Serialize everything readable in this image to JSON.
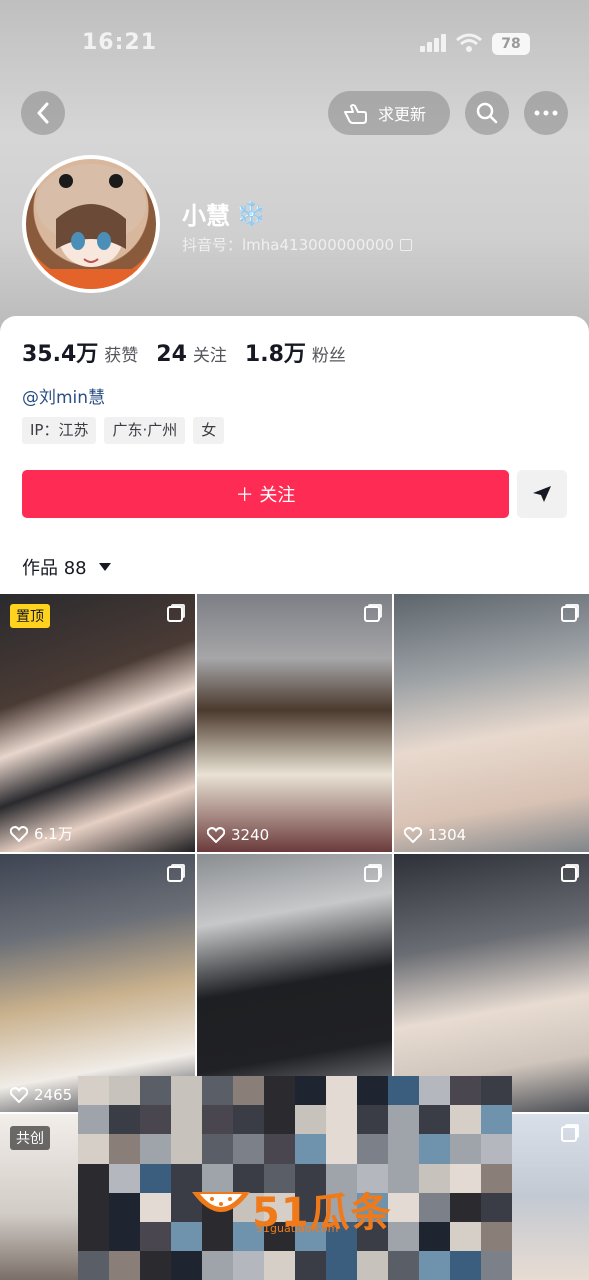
{
  "status": {
    "time": "16:21",
    "battery": "78"
  },
  "header": {
    "request_update_label": "求更新"
  },
  "profile": {
    "nickname": "小慧",
    "nickname_emoji": "❄️",
    "douyin_id": "抖音号：lmha413000000000",
    "stats": [
      {
        "value": "35.4万",
        "label": "获赞"
      },
      {
        "value": "24",
        "label": "关注"
      },
      {
        "value": "1.8万",
        "label": "粉丝"
      }
    ],
    "mention": "@刘min慧",
    "tags": [
      "IP：江苏",
      "广东·广州",
      "女"
    ],
    "follow_label": "＋ 关注"
  },
  "works": {
    "tab_label": "作品 88",
    "items": [
      {
        "badge": "置顶",
        "likes": "6.1万"
      },
      {
        "likes": "3240"
      },
      {
        "likes": "1304"
      },
      {
        "likes": "2465"
      },
      {
        "likes": ""
      },
      {
        "likes": ""
      },
      {
        "badge": "共创"
      },
      {},
      {}
    ]
  },
  "watermark": {
    "brand": "51瓜条",
    "url": "51guatiao.com"
  },
  "colors": {
    "accent": "#fe2c55",
    "pin": "#ffd21e",
    "watermark": "#f07a1a"
  }
}
